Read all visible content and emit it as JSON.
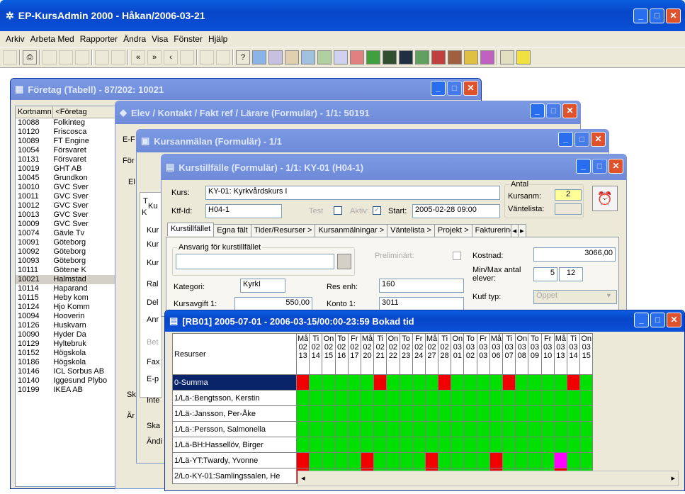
{
  "app": {
    "title": "EP-KursAdmin 2000 - Håkan/2006-03-21"
  },
  "menu": [
    "Arkiv",
    "Arbeta Med",
    "Rapporter",
    "Ändra",
    "Visa",
    "Fönster",
    "Hjälp"
  ],
  "foretag": {
    "title": "Företag (Tabell) - 87/202: 10021",
    "col1": "Kortnamn",
    "col2": "<Företag",
    "rows": [
      [
        "10088",
        "Folkinteg"
      ],
      [
        "10120",
        "Friscosca"
      ],
      [
        "10089",
        "FT Engine"
      ],
      [
        "10054",
        "Försvaret"
      ],
      [
        "10131",
        "Försvaret"
      ],
      [
        "10019",
        "GHT AB"
      ],
      [
        "10045",
        "Grundkon"
      ],
      [
        "10010",
        "GVC Sver"
      ],
      [
        "10011",
        "GVC Sver"
      ],
      [
        "10012",
        "GVC Sver"
      ],
      [
        "10013",
        "GVC Sver"
      ],
      [
        "10009",
        "GVC Sver"
      ],
      [
        "10074",
        "Gävle Tv"
      ],
      [
        "10091",
        "Göteborg"
      ],
      [
        "10092",
        "Göteborg"
      ],
      [
        "10093",
        "Göteborg"
      ],
      [
        "10111",
        "Götene K"
      ],
      [
        "10021",
        "Halmstad"
      ],
      [
        "10114",
        "Haparand"
      ],
      [
        "10115",
        "Heby kom"
      ],
      [
        "10124",
        "Hjo Komm"
      ],
      [
        "10094",
        "Hooverin"
      ],
      [
        "10126",
        "Huskvarn"
      ],
      [
        "10090",
        "Hyder Da"
      ],
      [
        "10129",
        "Hyltebruk"
      ],
      [
        "10152",
        "Högskola"
      ],
      [
        "10186",
        "Högskola"
      ],
      [
        "10146",
        "ICL Sorbus AB"
      ],
      [
        "10140",
        "Iggesund Plybo"
      ],
      [
        "10199",
        "IKEA AB"
      ]
    ],
    "selected_row": "10021"
  },
  "elev": {
    "title": "Elev / Kontakt / Fakt ref / Lärare (Formulär) - 1/1: 50191",
    "frag1": "E-F",
    "frag2": "För",
    "frag3": "El",
    "frag4": "Sk",
    "frag5": "Är"
  },
  "kursanmalan": {
    "title": "Kursanmälan (Formulär) - 1/1",
    "frags": [
      "Ku",
      "Kur",
      "Kur",
      "Kur",
      "Ral",
      "Del",
      "Anr",
      "Bet",
      "Fax",
      "E-p",
      "Inte"
    ],
    "tframe": "T",
    "kframe": "K",
    "bottom1": "Ska",
    "bottom2": "Ändi"
  },
  "kurstillfalle": {
    "title": "Kurstillfälle (Formulär) - 1/1: KY-01 (H04-1)",
    "kurs_label": "Kurs:",
    "kurs_value": "KY-01: Kyrkvårdskurs I",
    "ktfid_label": "Ktf-Id:",
    "ktfid_value": "H04-1",
    "test_label": "Test",
    "aktiv_label": "Aktiv:",
    "start_label": "Start:",
    "start_value": "2005-02-28 09:00",
    "antal_label": "Antal",
    "kursanm_label": "Kursanm:",
    "kursanm_value": "2",
    "vantelista_label": "Väntelista:",
    "tabs": [
      "Kurstillfället",
      "Egna fält",
      "Tider/Resurser >",
      "Kursanmälningar >",
      "Väntelista >",
      "Projekt >",
      "Faktureringsinfo"
    ],
    "ansvarig_label": "Ansvarig för kurstillfället",
    "preliminart_label": "Preliminärt:",
    "kostnad_label": "Kostnad:",
    "kostnad_value": "3066,00",
    "minmax_label1": "Min/Max antal",
    "minmax_label2": "elever:",
    "min_value": "5",
    "max_value": "12",
    "kategori_label": "Kategori:",
    "kategori_value": "KyrkI",
    "resenh_label": "Res enh:",
    "resenh_value": "160",
    "kutftyp_label": "Kutf typ:",
    "kutftyp_value": "Öppet",
    "kursavgift_label": "Kursavgift 1:",
    "kursavgift_value": "550,00",
    "konto_label": "Konto 1:",
    "konto_value": "3011"
  },
  "bokad": {
    "title": "[RB01] 2005-07-01 - 2006-03-15/00:00-23:59 Bokad tid",
    "res_header": "Resurser",
    "days": [
      [
        "Må",
        "02",
        "13"
      ],
      [
        "Ti",
        "02",
        "14"
      ],
      [
        "On",
        "02",
        "15"
      ],
      [
        "To",
        "02",
        "16"
      ],
      [
        "Fr",
        "02",
        "17"
      ],
      [
        "Må",
        "02",
        "20"
      ],
      [
        "Ti",
        "02",
        "21"
      ],
      [
        "On",
        "02",
        "22"
      ],
      [
        "To",
        "02",
        "23"
      ],
      [
        "Fr",
        "02",
        "24"
      ],
      [
        "Må",
        "02",
        "27"
      ],
      [
        "Ti",
        "02",
        "28"
      ],
      [
        "On",
        "03",
        "01"
      ],
      [
        "To",
        "03",
        "02"
      ],
      [
        "Fr",
        "03",
        "03"
      ],
      [
        "Må",
        "03",
        "06"
      ],
      [
        "Ti",
        "03",
        "07"
      ],
      [
        "On",
        "03",
        "08"
      ],
      [
        "To",
        "03",
        "09"
      ],
      [
        "Fr",
        "03",
        "10"
      ],
      [
        "Må",
        "03",
        "13"
      ],
      [
        "Ti",
        "03",
        "14"
      ],
      [
        "On",
        "03",
        "15"
      ]
    ],
    "resources": [
      "0-Summa",
      "1/Lä-:Bengtsson, Kerstin",
      "1/Lä-:Jansson, Per-Åke",
      "1/Lä-:Persson, Salmonella",
      "1/Lä-BH:Hassellöv, Birger",
      "1/Lä-YT:Twardy, Yvonne",
      "2/Lo-KY-01:Samlingssalen, He"
    ],
    "cells": [
      "rgggggrggggrggggrggggrg",
      "ggggggggggggggggggggggg",
      "ggggggggggggggggggggggg",
      "ggggggggggggggggggggggg",
      "ggggggggggggggggggggggg",
      "rggggrggggrggggrggggmgg",
      "rggggrggggrggggrggggrgg"
    ],
    "colors": {
      "g": "#00e000",
      "r": "#f00000",
      "m": "#ff00ff"
    }
  }
}
